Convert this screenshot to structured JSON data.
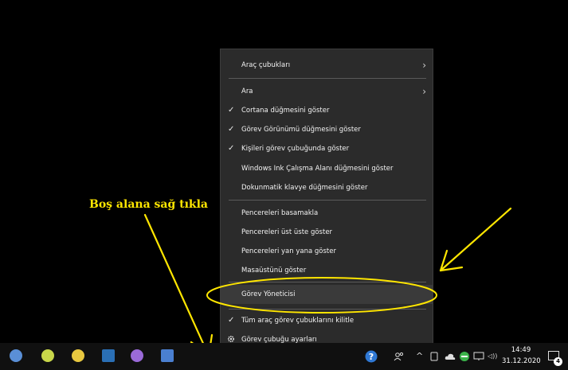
{
  "context_menu": {
    "items": [
      {
        "label": "Araç çubukları",
        "submenu": true
      },
      {
        "label": "Ara",
        "submenu": true
      },
      {
        "label": "Cortana düğmesini göster",
        "checked": true
      },
      {
        "label": "Görev Görünümü düğmesini göster",
        "checked": true
      },
      {
        "label": "Kişileri görev çubuğunda göster",
        "checked": true
      },
      {
        "label": "Windows Ink Çalışma Alanı düğmesini göster",
        "checked": false
      },
      {
        "label": "Dokunmatik klavye düğmesini göster",
        "checked": false
      },
      {
        "label": "Pencereleri basamakla"
      },
      {
        "label": "Pencereleri üst üste göster"
      },
      {
        "label": "Pencereleri yan yana göster"
      },
      {
        "label": "Masaüstünü göster"
      },
      {
        "label": "Görev Yöneticisi",
        "highlighted": true
      },
      {
        "label": "Tüm araç görev çubuklarını kilitle",
        "checked": true
      },
      {
        "label": "Görev çubuğu ayarları",
        "icon": "gear-icon"
      }
    ],
    "check_glyph": "✓",
    "submenu_glyph": "›"
  },
  "annotation": {
    "caption": "Boş alana sağ tıkla",
    "color": "#ffe600"
  },
  "taskbar": {
    "apps": [
      {
        "icon": "app-icon-1",
        "color": "#5a8fd6"
      },
      {
        "icon": "app-icon-2",
        "color": "#c8d64a"
      },
      {
        "icon": "app-icon-3",
        "color": "#e8c840"
      },
      {
        "icon": "app-icon-4",
        "color": "#2a6fb5"
      },
      {
        "icon": "app-icon-5",
        "color": "#9a6ad8"
      },
      {
        "icon": "app-icon-6",
        "color": "#4a7fd0"
      }
    ],
    "tray": {
      "help_icon": "question-circle-icon",
      "people_icon": "people-icon",
      "chevron": "^",
      "volume_glyph": "◁))"
    },
    "clock": {
      "time": "14:49",
      "date": "31.12.2020"
    },
    "notification_count": "4"
  }
}
